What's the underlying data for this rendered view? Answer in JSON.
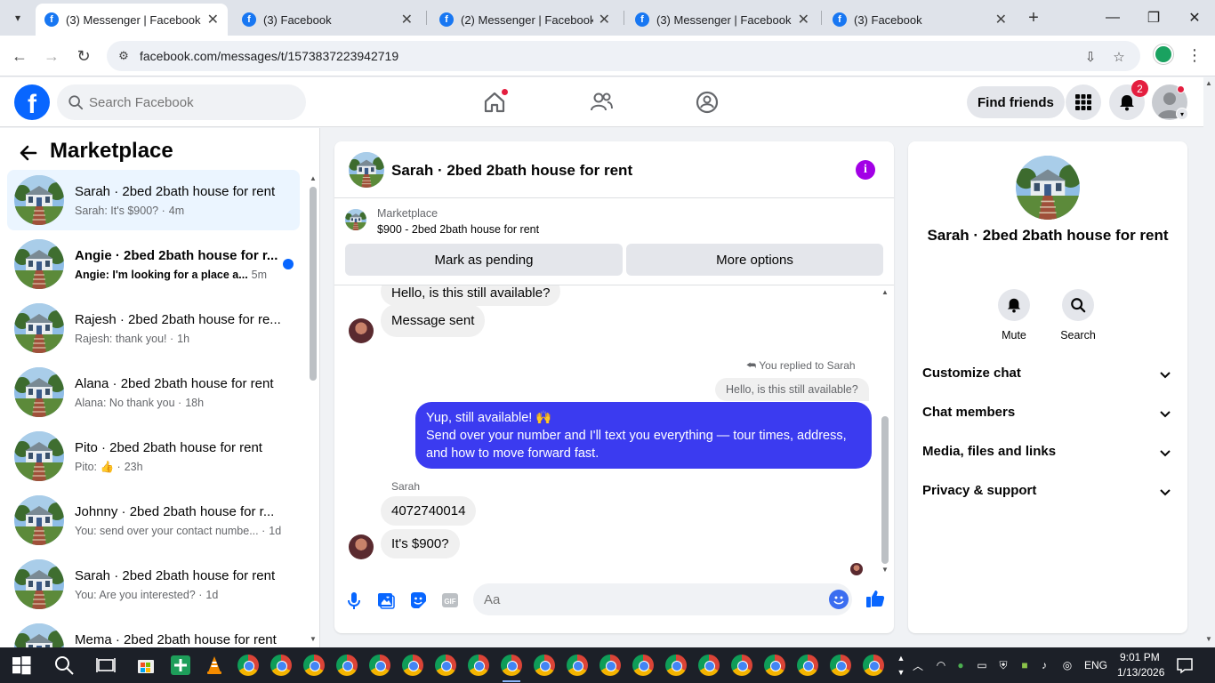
{
  "browser": {
    "tabs": [
      {
        "title": "(3) Messenger | Facebook",
        "active": true
      },
      {
        "title": "(3) Facebook",
        "active": false
      },
      {
        "title": "(2) Messenger | Facebook",
        "active": false
      },
      {
        "title": "(3) Messenger | Facebook",
        "active": false
      },
      {
        "title": "(3) Facebook",
        "active": false
      }
    ],
    "url": "facebook.com/messages/t/1573837223942719",
    "tab_close_glyph": "✕",
    "new_tab_glyph": "+"
  },
  "fb_header": {
    "logo": "f",
    "search_placeholder": "Search Facebook",
    "find_friends": "Find friends",
    "notification_count": "2",
    "colors": {
      "brand": "#0866ff",
      "badge": "#e41e3f"
    }
  },
  "left_panel": {
    "title": "Marketplace",
    "conversations": [
      {
        "name": "Sarah · 2bed 2bath house for rent",
        "preview": "Sarah: It's $900? ·",
        "time": "4m",
        "active": true,
        "unread": false
      },
      {
        "name": "Angie · 2bed 2bath house for r...",
        "preview": "Angie: I'm looking for a place a...",
        "time": "5m",
        "active": false,
        "unread": true
      },
      {
        "name": "Rajesh · 2bed 2bath house for re...",
        "preview": "Rajesh: thank you! ·",
        "time": "1h",
        "active": false,
        "unread": false
      },
      {
        "name": "Alana · 2bed 2bath house for rent",
        "preview": "Alana: No thank you ·",
        "time": "18h",
        "active": false,
        "unread": false
      },
      {
        "name": "Pito · 2bed 2bath house for rent",
        "preview": "Pito: 👍 ·",
        "time": "23h",
        "active": false,
        "unread": false
      },
      {
        "name": "Johnny · 2bed 2bath house for r...",
        "preview": "You: send over your contact numbe... ·",
        "time": "1d",
        "active": false,
        "unread": false
      },
      {
        "name": "Sarah · 2bed 2bath house for rent",
        "preview": "You: Are you interested? ·",
        "time": "1d",
        "active": false,
        "unread": false
      },
      {
        "name": "Mema · 2bed 2bath house for rent",
        "preview": "",
        "time": "",
        "active": false,
        "unread": false
      }
    ]
  },
  "chat": {
    "title": "Sarah · 2bed 2bath house for rent",
    "marketplace_label": "Marketplace",
    "item": "$900 - 2bed 2bath house for rent",
    "btn_pending": "Mark as pending",
    "btn_more": "More options",
    "messages": {
      "clipped_in": "Hello, is this still available?",
      "msg_sent": "Message sent",
      "replied_to": "You replied to Sarah",
      "quoted": "Hello, is this still available?",
      "out_line1": "Yup, still available! 🙌",
      "out_line2": "Send over your number and I'll text you everything — tour times, address, and how to move forward fast.",
      "sender": "Sarah",
      "in_number": "4072740014",
      "in_price": "It's $900?"
    },
    "composer_placeholder": "Aa",
    "colors": {
      "outgoing": "#3b3bf0",
      "incoming": "#f0f0f0",
      "accent": "#a200e6"
    }
  },
  "right_panel": {
    "name": "Sarah · 2bed 2bath house for rent",
    "actions": [
      {
        "label": "Mute",
        "icon": "bell-icon"
      },
      {
        "label": "Search",
        "icon": "search-icon"
      }
    ],
    "sections": [
      "Customize chat",
      "Chat members",
      "Media, files and links",
      "Privacy & support"
    ]
  },
  "taskbar": {
    "time": "9:01 PM",
    "date": "1/13/2026",
    "lang": "ENG"
  }
}
